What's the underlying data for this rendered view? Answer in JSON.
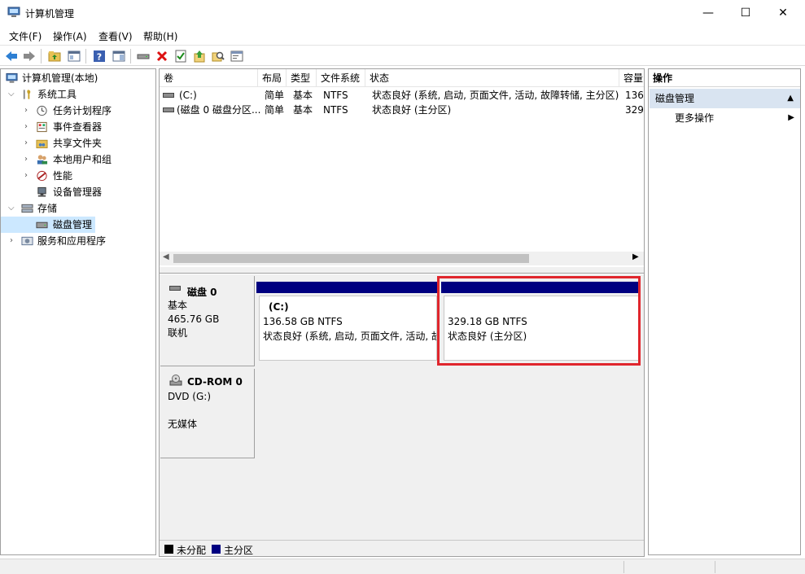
{
  "window": {
    "title": "计算机管理",
    "controls": {
      "minimize": "—",
      "maximize": "☐",
      "close": "✕"
    }
  },
  "menu": [
    "文件(F)",
    "操作(A)",
    "查看(V)",
    "帮助(H)"
  ],
  "tree": {
    "root": "计算机管理(本地)",
    "items": [
      {
        "label": "系统工具",
        "icon": "tools-icon"
      },
      {
        "label": "任务计划程序",
        "icon": "clock-icon"
      },
      {
        "label": "事件查看器",
        "icon": "event-viewer-icon"
      },
      {
        "label": "共享文件夹",
        "icon": "shared-folder-icon"
      },
      {
        "label": "本地用户和组",
        "icon": "users-icon"
      },
      {
        "label": "性能",
        "icon": "performance-icon"
      },
      {
        "label": "设备管理器",
        "icon": "device-manager-icon"
      },
      {
        "label": "存储",
        "icon": "storage-icon"
      },
      {
        "label": "磁盘管理",
        "icon": "disk-management-icon"
      },
      {
        "label": "服务和应用程序",
        "icon": "services-icon"
      }
    ]
  },
  "volumes": {
    "columns": [
      "卷",
      "布局",
      "类型",
      "文件系统",
      "状态",
      "容量"
    ],
    "rows": [
      [
        "(C:)",
        "简单",
        "基本",
        "NTFS",
        "状态良好 (系统, 启动, 页面文件, 活动, 故障转储, 主分区)",
        "136"
      ],
      [
        "(磁盘 0 磁盘分区...",
        "简单",
        "基本",
        "NTFS",
        "状态良好 (主分区)",
        "329"
      ]
    ]
  },
  "disks": [
    {
      "name": "磁盘 0",
      "type": "基本",
      "size": "465.76 GB",
      "status": "联机",
      "partitions": [
        {
          "label": "(C:)",
          "size": "136.58 GB NTFS",
          "status": "状态良好 (系统, 启动, 页面文件, 活动, 故"
        },
        {
          "label": "",
          "size": "329.18 GB NTFS",
          "status": "状态良好 (主分区)"
        }
      ]
    },
    {
      "name": "CD-ROM 0",
      "type": "DVD (G:)",
      "status": "无媒体"
    }
  ],
  "legend": [
    {
      "label": "未分配",
      "color": "#000000"
    },
    {
      "label": "主分区",
      "color": "#000080"
    }
  ],
  "actions": {
    "title": "操作",
    "section": "磁盘管理",
    "more": "更多操作"
  }
}
